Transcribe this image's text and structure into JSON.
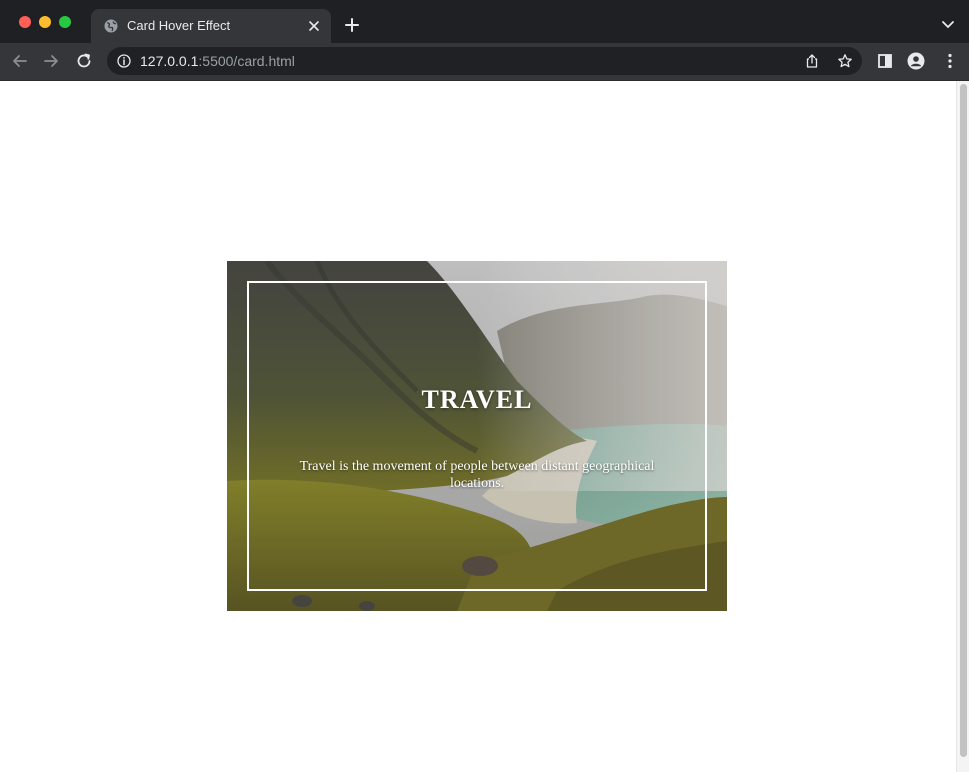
{
  "browser": {
    "tab_title": "Card Hover Effect",
    "url_host": "127.0.0.1",
    "url_rest": ":5500/card.html"
  },
  "card": {
    "title": "TRAVEL",
    "text": "Travel is the movement of people between distant geographical locations.",
    "image": "mountain-valley-beach-landscape"
  },
  "colors": {
    "chrome_dark": "#1f2023",
    "chrome_toolbar": "#35363a",
    "omnibox": "#202124",
    "card_border": "#ffffff"
  },
  "icons": {
    "tab_favicon": "globe-icon",
    "tab_close": "close-icon",
    "new_tab": "plus-icon",
    "back": "back-arrow-icon",
    "forward": "forward-arrow-icon",
    "reload": "reload-icon",
    "site_info": "info-icon",
    "share": "share-icon",
    "bookmark": "star-icon",
    "side_panel": "side-panel-icon",
    "profile": "profile-icon",
    "menu": "more-vert-icon"
  }
}
